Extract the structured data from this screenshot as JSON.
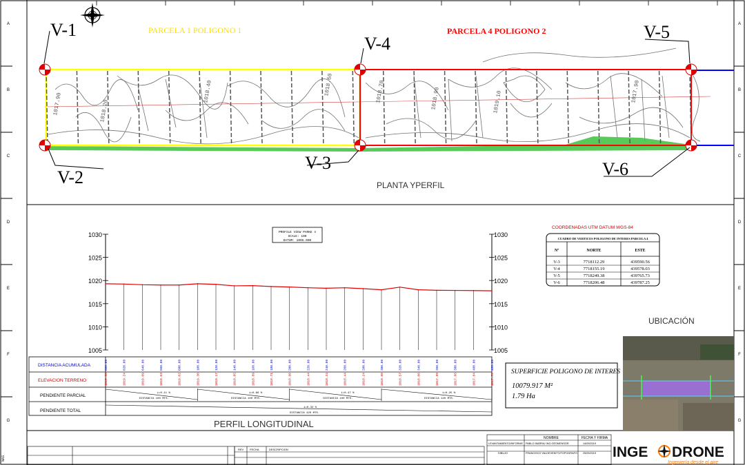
{
  "sheet": {
    "border_letters": [
      "A",
      "B",
      "C",
      "D",
      "E",
      "F",
      "G"
    ],
    "left_edge_text": "NAS"
  },
  "plan": {
    "parcel1_title": "PARCELA  1  POLIGONO  1",
    "parcel2_title": "PARCELA  4  POLIGONO  2",
    "vertices": [
      "V-1",
      "V-2",
      "V-3",
      "V-4",
      "V-5",
      "V-6"
    ],
    "contours": [
      "1017.90",
      "1018.20",
      "1018.40",
      "1018.60",
      "1018.70",
      "1018.90",
      "1019.10",
      "1017.90"
    ],
    "plan_title": "PLANTA YPERFIL",
    "colors": {
      "parcel1": "#ffff00",
      "parcel2": "#ff0000",
      "contour": "#606060",
      "road": "#0000ff"
    }
  },
  "profile": {
    "box_title": "PROFILE VIEW PARKE 4",
    "box_scale": "SCALE: 100",
    "box_datum": "DATUM: 1005.000",
    "y_ticks": [
      "1030",
      "1025",
      "1020",
      "1015",
      "1010",
      "1005"
    ],
    "chart_title": "PERFIL LONGITUDINAL",
    "row_labels": [
      "DISTANCIA ACUMULADA",
      "ELEVACION TERRENO",
      "PENDIENTE  PARCIAL",
      "PENDIENTE  TOTAL"
    ],
    "distances": [
      "000.00",
      "020.00",
      "040.00",
      "060.00",
      "080.00",
      "100.00",
      "120.00",
      "140.00",
      "160.00",
      "180.00",
      "200.00",
      "220.00",
      "240.00",
      "260.00",
      "280.00",
      "300.00",
      "320.00",
      "340.00",
      "360.00",
      "380.00",
      "400.00",
      "420.00"
    ],
    "elevations": [
      "1019.30",
      "1019.24",
      "1019.09",
      "1019.03",
      "1019.02",
      "1019.30",
      "1019.17",
      "1018.85",
      "1018.89",
      "1018.71",
      "1018.60",
      "1018.44",
      "1018.34",
      "1018.44",
      "1018.24",
      "1018.00",
      "1018.57",
      "1018.00",
      "1017.89",
      "1017.86",
      "1017.84",
      "1017.78"
    ],
    "partial_slopes": [
      "i=0.11 %",
      "i=0.66 %",
      "i=0.47 %",
      "i=0.25 %"
    ],
    "partial_dist": [
      "DISTANCIA 100 MTS.",
      "DISTANCIA 100 MTS.",
      "DISTANCIA 100 MTS.",
      "DISTANCIA 120 MTS."
    ],
    "total_slope": "i=0.32 %",
    "total_dist": "DISTANCIA 420 MTS."
  },
  "chart_data": {
    "type": "line",
    "title": "PERFIL LONGITUDINAL",
    "xlabel": "DISTANCIA ACUMULADA",
    "ylabel": "",
    "ylim": [
      1005,
      1030
    ],
    "x": [
      0,
      20,
      40,
      60,
      80,
      100,
      120,
      140,
      160,
      180,
      200,
      220,
      240,
      260,
      280,
      300,
      320,
      340,
      360,
      380,
      400,
      420
    ],
    "series": [
      {
        "name": "ELEVACION TERRENO",
        "values": [
          1019.3,
          1019.24,
          1019.09,
          1019.03,
          1019.02,
          1019.3,
          1019.17,
          1018.85,
          1018.89,
          1018.71,
          1018.6,
          1018.44,
          1018.34,
          1018.44,
          1018.24,
          1018.0,
          1018.57,
          1018.0,
          1017.89,
          1017.86,
          1017.84,
          1017.78
        ]
      }
    ],
    "grid": false
  },
  "coords": {
    "heading": "COORDENADAS  UTM  DATUM  WGS-84",
    "table_title": "CUADRO DE VERTICES POLIGONO DE INTERES PARCELA 4",
    "headers": [
      "Nº",
      "NORTE",
      "ESTE"
    ],
    "rows": [
      [
        "V-3",
        "7718112.29",
        "439590.56"
      ],
      [
        "V-4",
        "7718155.19",
        "439578.03"
      ],
      [
        "V-5",
        "7718249.38",
        "439765.73"
      ],
      [
        "V-6",
        "7718206.48",
        "439787.25"
      ]
    ]
  },
  "area": {
    "title": "SUPERFICIE  POLIGONO  DE  INTERES",
    "m2": "10079.917  M²",
    "ha": "1.79  Ha"
  },
  "location": {
    "title": "UBICACIÓN"
  },
  "title_block": {
    "headers": [
      "NOMBRE",
      "FECHA Y FIRMA"
    ],
    "rows": [
      [
        "LEVANTAMIENTO/INFORME",
        "PABLO IBARRA/ ING.GEOMENSOR",
        "14/09/2019"
      ],
      [
        "DIBUJO",
        "FRANCISCO VALDEVENITO/TOPOGRAFO",
        "25/09/2019"
      ]
    ],
    "rev_headers": [
      "REV",
      "FECHA",
      "DESCRIPCION"
    ],
    "logo_left": "INGE",
    "logo_right": "DRONE",
    "tagline": "Ingeniería desde el aire"
  }
}
